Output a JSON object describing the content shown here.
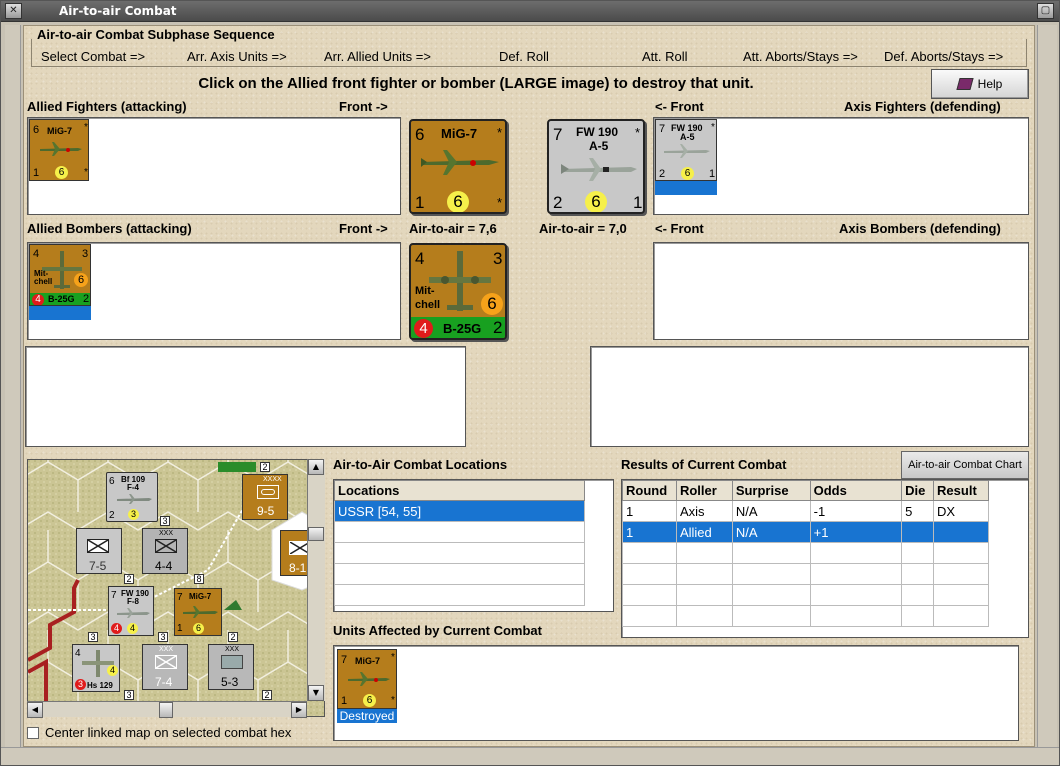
{
  "window": {
    "title": "Air-to-air Combat"
  },
  "sequence": {
    "legend": "Air-to-air Combat Subphase Sequence",
    "steps": [
      "Select Combat =>",
      "Arr. Axis Units =>",
      "Arr. Allied Units =>",
      "Def. Roll",
      "Att. Roll",
      "Att. Aborts/Stays =>",
      "Def. Aborts/Stays =>"
    ]
  },
  "instruction": "Click on the Allied front fighter or bomber (LARGE image) to destroy that unit.",
  "help_label": "Help",
  "labels": {
    "allied_fighters": "Allied Fighters (attacking)",
    "front_right": "Front ->",
    "front_left": "<- Front",
    "axis_fighters": "Axis Fighters (defending)",
    "allied_bombers": "Allied Bombers (attacking)",
    "axis_bombers": "Axis Bombers (defending)",
    "allied_ata": "Air-to-air = 7,6",
    "axis_ata": "Air-to-air = 7,0"
  },
  "units": {
    "mig7": {
      "name": "MiG-7",
      "tl": "6",
      "bl": "1",
      "circle": "6",
      "star": "*"
    },
    "mig7_destroyed": {
      "name": "MiG-7",
      "tl": "7",
      "bl": "1",
      "circle": "6",
      "star": "*",
      "status": "Destroyed"
    },
    "fw190": {
      "name": "FW 190",
      "sub": "A-5",
      "tl": "7",
      "bl": "2",
      "circle": "6",
      "br": "1",
      "star": "*"
    },
    "b25": {
      "name": "B-25G",
      "tl": "4",
      "tr": "3",
      "mid1": "Mit-",
      "mid2": "chell",
      "circle": "6",
      "red": "4",
      "br": "2"
    }
  },
  "locations": {
    "title": "Air-to-Air Combat Locations",
    "header": "Locations",
    "rows": [
      "USSR [54, 55]"
    ]
  },
  "results": {
    "title": "Results of Current Combat",
    "chart_button": "Air-to-air Combat Chart",
    "headers": [
      "Round",
      "Roller",
      "Surprise",
      "Odds",
      "Die",
      "Result"
    ],
    "rows": [
      [
        "1",
        "Axis",
        "N/A",
        "-1",
        "5",
        "DX"
      ],
      [
        "1",
        "Allied",
        "N/A",
        "+1",
        "",
        ""
      ]
    ]
  },
  "affected_title": "Units Affected by Current Combat",
  "center_map_label": "Center linked map on selected combat hex",
  "map": {
    "bf109": {
      "name": "Bf 109",
      "sub": "F-4",
      "tl": "6",
      "bl": "2",
      "circle": "3"
    },
    "fw190": {
      "name": "FW 190",
      "sub": "F-8",
      "tl": "7",
      "red": "4",
      "circle": "4"
    },
    "mig7": {
      "name": "MiG-7",
      "tl": "7",
      "bl": "1",
      "circle": "6"
    },
    "hs129": {
      "name": "Hs 129",
      "tl": "4",
      "red": "3",
      "circle": "4"
    },
    "corps1": {
      "size": "XXX",
      "str": "4-4"
    },
    "corps2": {
      "str": "7-5"
    },
    "corps3": {
      "size": "XXX",
      "str": "7-4"
    },
    "corps4": {
      "size": "XXX",
      "str": "5-3"
    },
    "armor1": {
      "size": "XXXX",
      "str": "9-5"
    },
    "armor2": {
      "str": "8-1"
    },
    "stack": [
      "2",
      "3",
      "8",
      "2",
      "3",
      "3",
      "2",
      "3",
      "2"
    ]
  }
}
